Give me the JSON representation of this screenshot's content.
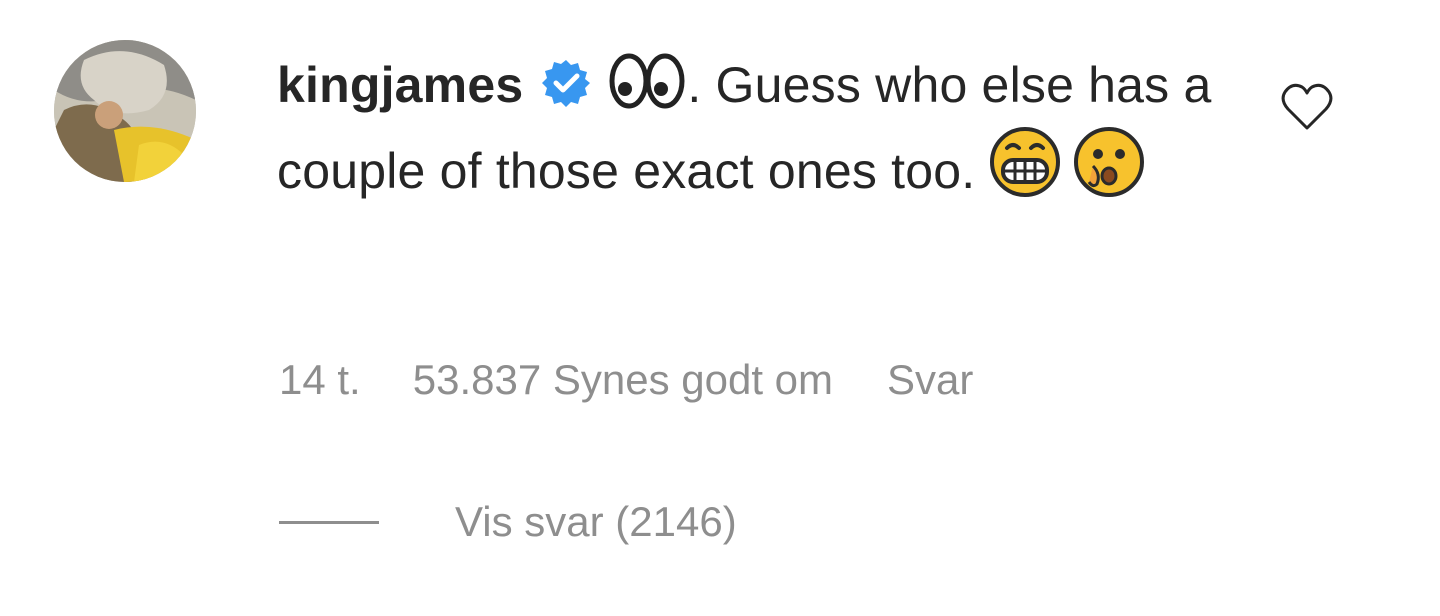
{
  "comment": {
    "username": "kingjames",
    "text_part1": ". Guess who else has a couple of those exact ones too.",
    "emojis": [
      "eyes-emoji",
      "grimacing-emoji",
      "hushed-emoji"
    ],
    "verified_icon": "verified-badge-icon",
    "like_icon": "heart-outline-icon",
    "time": "14 t.",
    "likes": "53.837 Synes godt om",
    "reply_label": "Svar",
    "view_replies_label": "Vis svar (2146)",
    "colors": {
      "text": "#262626",
      "meta": "#8e8e8e",
      "verified": "#3897f0"
    }
  }
}
